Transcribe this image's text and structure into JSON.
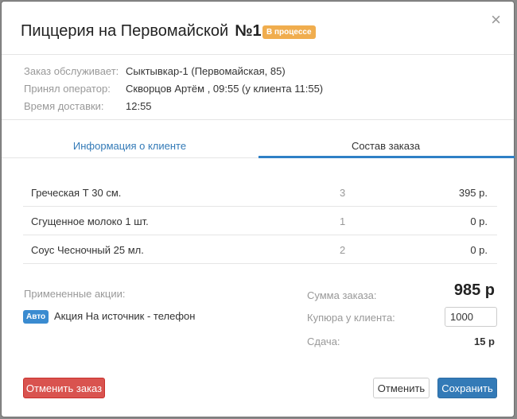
{
  "header": {
    "title": "Пиццерия на Первомайской",
    "number": "№1",
    "status": "В процессе",
    "close": "×"
  },
  "info": [
    {
      "label": "Заказ обслуживает:",
      "value": "Сыктывкар-1 (Первомайская, 85)"
    },
    {
      "label": "Принял оператор:",
      "value": "Скворцов Артём , 09:55 (у клиента 11:55)"
    },
    {
      "label": "Время доставки:",
      "value": "12:55"
    }
  ],
  "tabs": {
    "client": "Информация о клиенте",
    "order": "Состав заказа",
    "active": "order"
  },
  "items": [
    {
      "name": "Греческая Т 30 см.",
      "qty": "3",
      "price": "395 р."
    },
    {
      "name": "Сгущенное молоко 1 шт.",
      "qty": "1",
      "price": "0 р."
    },
    {
      "name": "Соус Чесночный 25 мл.",
      "qty": "2",
      "price": "0 р."
    }
  ],
  "promotions": {
    "label": "Примененные акции:",
    "badge": "Авто",
    "text": "Акция На источник - телефон"
  },
  "summary": {
    "total_label": "Сумма заказа:",
    "total_value": "985 р",
    "cash_label": "Купюра у клиента:",
    "cash_value": "1000",
    "change_label": "Сдача:",
    "change_value": "15 р"
  },
  "buttons": {
    "cancel_order": "Отменить заказ",
    "cancel": "Отменить",
    "save": "Сохранить"
  },
  "colors": {
    "status": "#f0ad4e",
    "accent": "#337ab7",
    "danger": "#d9534f"
  }
}
